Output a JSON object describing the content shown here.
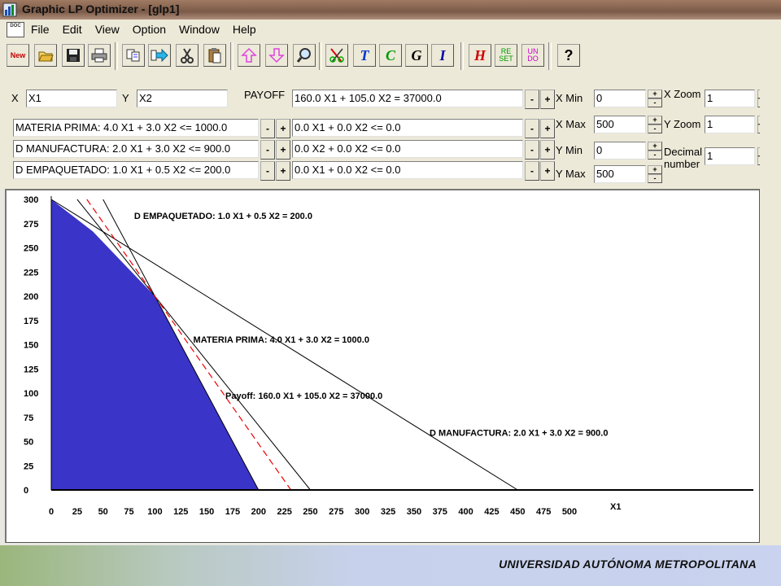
{
  "window": {
    "title": "Graphic LP Optimizer - [glp1]",
    "doc_icon_text": "DOC"
  },
  "menu": [
    "File",
    "Edit",
    "View",
    "Option",
    "Window",
    "Help"
  ],
  "toolbar": {
    "buttons": [
      {
        "name": "new",
        "text": "New",
        "color": "#c00000"
      },
      {
        "name": "open",
        "icon": "open-folder-icon"
      },
      {
        "name": "save",
        "icon": "floppy-disk-icon"
      },
      {
        "name": "print",
        "icon": "printer-icon"
      },
      {
        "name": "copy",
        "icon": "copy-icon"
      },
      {
        "name": "paste-arrow",
        "icon": "arrow-right-icon"
      },
      {
        "name": "cut",
        "icon": "scissors-icon"
      },
      {
        "name": "paste",
        "icon": "clipboard-icon"
      },
      {
        "name": "move-up",
        "icon": "up-arrow-outline-icon"
      },
      {
        "name": "move-down",
        "icon": "down-arrow-outline-icon"
      },
      {
        "name": "zoom",
        "icon": "magnifier-icon"
      },
      {
        "name": "cut-red",
        "icon": "red-scissors-icon"
      },
      {
        "name": "title",
        "text": "T",
        "color": "#0033cc"
      },
      {
        "name": "constraint",
        "text": "C",
        "color": "#009900"
      },
      {
        "name": "graph",
        "text": "G",
        "color": "#000000"
      },
      {
        "name": "info",
        "text": "I",
        "color": "#0000aa"
      },
      {
        "name": "help-h",
        "text": "H",
        "color": "#cc0000"
      },
      {
        "name": "reset",
        "text": "RE SET",
        "color": "#009900"
      },
      {
        "name": "undo",
        "text": "UN DO",
        "color": "#cc00cc"
      },
      {
        "name": "help-q",
        "text": "?",
        "color": "#000000"
      }
    ]
  },
  "controls": {
    "x_label": "X",
    "x_value": "X1",
    "y_label": "Y",
    "y_value": "X2",
    "payoff_label": "PAYOFF",
    "payoff_value": "160.0 X1 + 105.0 X2 = 37000.0",
    "left_constraints": [
      "MATERIA PRIMA: 4.0 X1 +  3.0 X2 <=  1000.0",
      " D MANUFACTURA: 2.0 X1 +  3.0 X2 <=  900.0",
      " D EMPAQUETADO: 1.0 X1 +  0.5 X2 <=  200.0"
    ],
    "right_constraints": [
      "0.0 X1 +  0.0 X2 <=  0.0",
      "0.0 X2 +  0.0 X2 <=  0.0",
      "0.0 X1 +  0.0 X2 <=  0.0"
    ],
    "minus": "-",
    "plus": "+",
    "range": [
      {
        "label": "X Min",
        "value": "0"
      },
      {
        "label": "X Max",
        "value": "500"
      },
      {
        "label": "Y Min",
        "value": "0"
      },
      {
        "label": "Y Max",
        "value": "500"
      }
    ],
    "x_zoom_label": "X Zoom",
    "x_zoom_value": "1",
    "y_zoom_label": "Y Zoom",
    "y_zoom_value": "1",
    "decimal_label_1": "Decimal",
    "decimal_label_2": "number",
    "decimal_value": "1",
    "spin_up": "+",
    "spin_down": "-"
  },
  "chart_data": {
    "type": "line",
    "xlabel": "X1",
    "ylabel": "",
    "xlim": [
      0,
      500
    ],
    "ylim": [
      0,
      300
    ],
    "x_ticks": [
      0,
      25,
      50,
      75,
      100,
      125,
      150,
      175,
      200,
      225,
      250,
      275,
      300,
      325,
      350,
      375,
      400,
      425,
      450,
      475,
      500
    ],
    "y_ticks": [
      0,
      25,
      50,
      75,
      100,
      125,
      150,
      175,
      200,
      225,
      250,
      275,
      300
    ],
    "feasible_region": {
      "color": "#3a34c8",
      "vertices": [
        [
          0,
          300
        ],
        [
          40,
          267
        ],
        [
          100,
          200
        ],
        [
          200,
          0
        ],
        [
          0,
          0
        ]
      ]
    },
    "lines": [
      {
        "label": "D EMPAQUETADO:  1.0 X1 +   0.5 X2 = 200.0",
        "a": 1.0,
        "b": 0.5,
        "c": 200.0,
        "color": "#000000",
        "dash": false
      },
      {
        "label": "MATERIA PRIMA:   4.0 X1 +   3.0 X2 = 1000.0",
        "a": 4.0,
        "b": 3.0,
        "c": 1000.0,
        "color": "#000000",
        "dash": false
      },
      {
        "label": "D MANUFACTURA:   2.0 X1 +   3.0 X2 = 900.0",
        "a": 2.0,
        "b": 3.0,
        "c": 900.0,
        "color": "#000000",
        "dash": false
      },
      {
        "label": "Payoff:  160.0 X1 + 105.0 X2 = 37000.0",
        "a": 160.0,
        "b": 105.0,
        "c": 37000.0,
        "color": "#ee0000",
        "dash": true
      }
    ]
  },
  "footer": {
    "text": "UNIVERSIDAD AUTÓNOMA METROPOLITANA"
  }
}
